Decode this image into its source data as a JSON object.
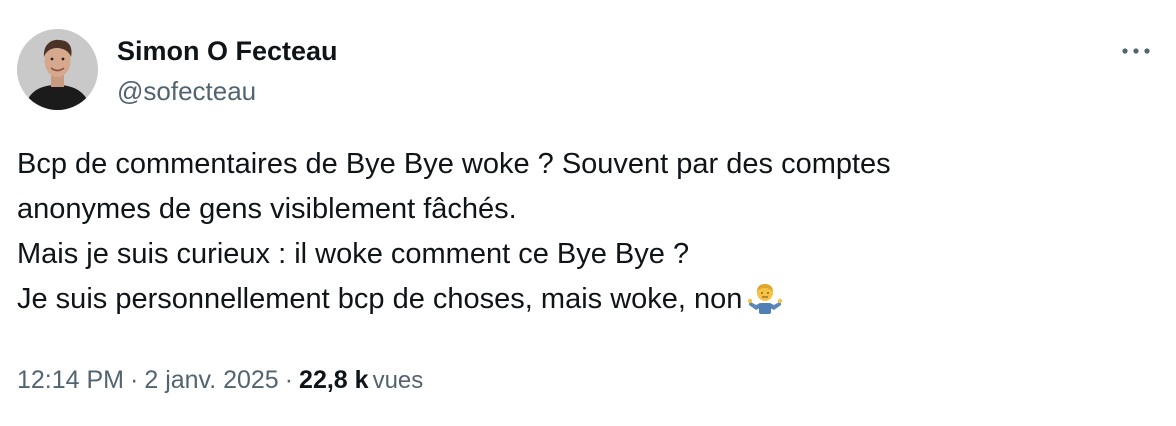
{
  "author": {
    "name": "Simon O Fecteau",
    "handle": "@sofecteau"
  },
  "tweet": {
    "lines": [
      "Bcp de commentaires de Bye Bye woke ? Souvent par des comptes",
      "anonymes de gens visiblement fâchés.",
      "Mais je suis curieux : il woke comment ce Bye Bye ?",
      "Je suis personnellement bcp de choses, mais woke, non"
    ],
    "emoji": "person-shrugging-icon"
  },
  "meta": {
    "time": "12:14 PM",
    "separator": "·",
    "date": "2 janv. 2025",
    "views_count": "22,8 k",
    "views_label": "vues"
  },
  "colors": {
    "text": "#0f1419",
    "secondary": "#536471",
    "background": "#ffffff"
  }
}
